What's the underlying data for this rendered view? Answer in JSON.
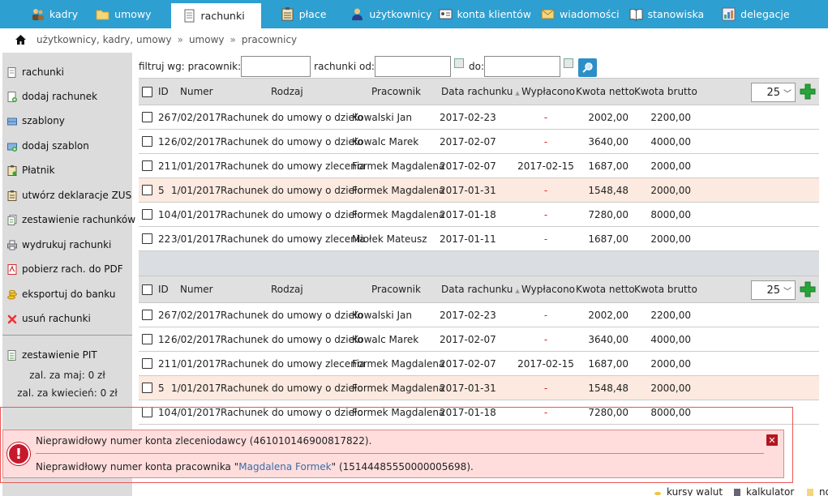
{
  "nav": {
    "tabs": [
      {
        "label": "kadry",
        "icon": "people-icon"
      },
      {
        "label": "umowy",
        "icon": "folder-icon"
      },
      {
        "label": "rachunki",
        "icon": "document-icon"
      },
      {
        "label": "płace",
        "icon": "clipboard-icon"
      },
      {
        "label": "użytkownicy",
        "icon": "user-icon"
      },
      {
        "label": "konta klientów",
        "icon": "id-card-icon"
      },
      {
        "label": "wiadomości",
        "icon": "envelope-icon"
      },
      {
        "label": "stanowiska",
        "icon": "book-icon"
      },
      {
        "label": "delegacje",
        "icon": "chart-icon"
      }
    ],
    "active": "rachunki"
  },
  "breadcrumb": {
    "items": [
      "użytkownicy, kadry, umowy",
      "umowy",
      "pracownicy"
    ],
    "sep": "»"
  },
  "sidebar": {
    "items": [
      {
        "label": "rachunki",
        "icon": "document-icon"
      },
      {
        "label": "dodaj rachunek",
        "icon": "document-add-icon"
      },
      {
        "label": "szablony",
        "icon": "drawer-icon"
      },
      {
        "label": "dodaj szablon",
        "icon": "drawer-add-icon"
      },
      {
        "label": "Płatnik",
        "icon": "clipboard-icon"
      },
      {
        "label": "utwórz deklaracje ZUS",
        "icon": "clipboard-icon"
      },
      {
        "label": "zestawienie rachunków",
        "icon": "documents-icon"
      },
      {
        "label": "wydrukuj rachunki",
        "icon": "printer-icon"
      },
      {
        "label": "pobierz rach. do PDF",
        "icon": "pdf-icon"
      },
      {
        "label": "eksportuj do banku",
        "icon": "coins-icon"
      },
      {
        "label": "usuń rachunki",
        "icon": "delete-icon"
      }
    ],
    "pit": {
      "label": "zestawienie PIT",
      "icon": "document-icon"
    },
    "zal_may": "zal. za maj: 0 zł",
    "zal_april": "zal. za kwiecień: 0 zł"
  },
  "filter": {
    "employee_label": "filtruj wg: pracownik:",
    "employee_value": "",
    "from_label": "rachunki od:",
    "from_value": "",
    "to_label": "do:",
    "to_value": ""
  },
  "table": {
    "columns": [
      "ID",
      "Numer",
      "Rodzaj",
      "Pracownik",
      "Data rachunku",
      "Wypłacono",
      "Kwota netto",
      "Kwota brutto"
    ],
    "per_page": "25",
    "rows": [
      {
        "id": "26",
        "numer": "7/02/2017",
        "rodzaj": "Rachunek do umowy o dzieło",
        "pracownik": "Kowalski Jan",
        "data": "2017-02-23",
        "wyplacono": "-",
        "netto": "2002,00",
        "brutto": "2200,00",
        "highlight": false
      },
      {
        "id": "12",
        "numer": "6/02/2017",
        "rodzaj": "Rachunek do umowy o dzieło",
        "pracownik": "Kowalc Marek",
        "data": "2017-02-07",
        "wyplacono": "-",
        "netto": "3640,00",
        "brutto": "4000,00",
        "highlight": false
      },
      {
        "id": "21",
        "numer": "1/01/2017",
        "rodzaj": "Rachunek do umowy zlecenia",
        "pracownik": "Formek Magdalena",
        "data": "2017-02-07",
        "wyplacono": "2017-02-15",
        "netto": "1687,00",
        "brutto": "2000,00",
        "highlight": false
      },
      {
        "id": "5",
        "numer": "1/01/2017",
        "rodzaj": "Rachunek do umowy o dzieło",
        "pracownik": "Formek Magdalena",
        "data": "2017-01-31",
        "wyplacono": "-",
        "netto": "1548,48",
        "brutto": "2000,00",
        "highlight": true
      },
      {
        "id": "10",
        "numer": "4/01/2017",
        "rodzaj": "Rachunek do umowy o dzieło",
        "pracownik": "Formek Magdalena",
        "data": "2017-01-18",
        "wyplacono": "-",
        "netto": "7280,00",
        "brutto": "8000,00",
        "highlight": false
      },
      {
        "id": "22",
        "numer": "3/01/2017",
        "rodzaj": "Rachunek do umowy zlecenia",
        "pracownik": "Miołek Mateusz",
        "data": "2017-01-11",
        "wyplacono": "-",
        "netto": "1687,00",
        "brutto": "2000,00",
        "highlight": false
      }
    ]
  },
  "table2": {
    "rows": [
      {
        "id": "26",
        "numer": "7/02/2017",
        "rodzaj": "Rachunek do umowy o dzieło",
        "pracownik": "Kowalski Jan",
        "data": "2017-02-23",
        "wyplacono": "-",
        "netto": "2002,00",
        "brutto": "2200,00",
        "highlight": false
      },
      {
        "id": "12",
        "numer": "6/02/2017",
        "rodzaj": "Rachunek do umowy o dzieło",
        "pracownik": "Kowalc Marek",
        "data": "2017-02-07",
        "wyplacono": "-",
        "netto": "3640,00",
        "brutto": "4000,00",
        "highlight": false
      },
      {
        "id": "21",
        "numer": "1/01/2017",
        "rodzaj": "Rachunek do umowy zlecenia",
        "pracownik": "Formek Magdalena",
        "data": "2017-02-07",
        "wyplacono": "2017-02-15",
        "netto": "1687,00",
        "brutto": "2000,00",
        "highlight": false
      },
      {
        "id": "5",
        "numer": "1/01/2017",
        "rodzaj": "Rachunek do umowy o dzieło",
        "pracownik": "Formek Magdalena",
        "data": "2017-01-31",
        "wyplacono": "-",
        "netto": "1548,48",
        "brutto": "2000,00",
        "highlight": true
      },
      {
        "id": "10",
        "numer": "4/01/2017",
        "rodzaj": "Rachunek do umowy o dzieło",
        "pracownik": "Formek Magdalena",
        "data": "2017-01-18",
        "wyplacono": "-",
        "netto": "7280,00",
        "brutto": "8000,00",
        "highlight": false
      }
    ]
  },
  "error": {
    "line1": "Nieprawidłowy numer konta zleceniodawcy (461010146900817822).",
    "line2_prefix": "Nieprawidłowy numer konta pracownika \"",
    "line2_link": "Magdalena Formek",
    "line2_suffix": "\" (15144485550000005698)."
  },
  "footer": {
    "kursy": "kursy walut",
    "kalkulator": "kalkulator",
    "third": "no"
  },
  "colors": {
    "nav_bg": "#2d9fd0",
    "sidebar_bg": "#dcdcdc",
    "highlight_row": "#fce9df",
    "error_bg": "#ffdddd",
    "add_green": "#27a43a",
    "dash_red": "#dd2222"
  }
}
